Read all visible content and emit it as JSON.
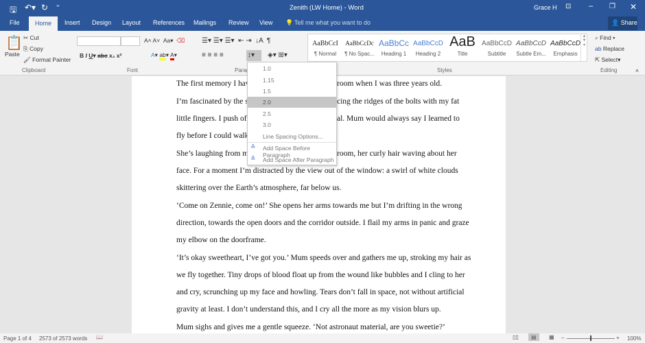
{
  "title": "Zenith (LW Home) - Word",
  "user": "Grace H",
  "tabs": [
    "File",
    "Home",
    "Insert",
    "Design",
    "Layout",
    "References",
    "Mailings",
    "Review",
    "View"
  ],
  "tell_me": "Tell me what you want to do",
  "share": "Share",
  "clipboard": {
    "paste": "Paste",
    "cut": "Cut",
    "copy": "Copy",
    "format_painter": "Format Painter",
    "label": "Clipboard"
  },
  "font": {
    "label": "Font",
    "name": "",
    "size": ""
  },
  "paragraph": {
    "label": "Paragraph"
  },
  "styles": {
    "label": "Styles",
    "items": [
      {
        "preview": "AaBbCcI",
        "name": "¶ Normal"
      },
      {
        "preview": "AaBbCcDc",
        "name": "¶ No Spac..."
      },
      {
        "preview": "AaBbCc",
        "name": "Heading 1"
      },
      {
        "preview": "AaBbCcD",
        "name": "Heading 2"
      },
      {
        "preview": "AaB",
        "name": "Title"
      },
      {
        "preview": "AaBbCcD",
        "name": "Subtitle"
      },
      {
        "preview": "AaBbCcD",
        "name": "Subtle Em..."
      },
      {
        "preview": "AaBbCcD",
        "name": "Emphasis"
      }
    ]
  },
  "editing": {
    "label": "Editing",
    "find": "Find",
    "replace": "Replace",
    "select": "Select"
  },
  "line_spacing_menu": {
    "options": [
      "1.0",
      "1.15",
      "1.5",
      "2.0",
      "2.5",
      "3.0"
    ],
    "selected": "2.0",
    "more": "Line Spacing Options...",
    "before": "Add Space Before Paragraph",
    "after": "Add Space After Paragraph"
  },
  "document": {
    "lines": [
      "The first memory I hav",
      "room when I was three years old.",
      "I’m fascinated by the st",
      "cing the ridges of the bolts with my fat",
      "little fingers. I push off",
      "al. Mum would always say I learned to",
      "fly before I could walk",
      "She’s laughing from m",
      "room, her curly hair waving about her",
      "face. For a moment I’m distracted by the view out of the window: a swirl of white clouds",
      "skittering over the Earth’s atmosphere, far below us.",
      "‘Come on Zennie, come on!’ She opens her arms towards me but I’m drifting in the wrong",
      "direction, towards the open doors and the corridor outside. I flail my arms in panic and graze",
      "my elbow on the doorframe.",
      "‘It’s okay sweetheart, I’ve got you.’ Mum speeds over and gathers me up, stroking my hair as",
      "we fly together. Tiny drops of blood float up from the wound like bubbles and I cling to her",
      "and cry, scrunching up my face and howling. Tears don’t fall in space, not without artificial",
      "gravity at least. I don’t understand this, and I cry all the more as my vision blurs up.",
      "Mum sighs and gives me a gentle squeeze. ‘Not astronaut material, are you sweetie?’"
    ]
  },
  "status": {
    "page": "Page 1 of 4",
    "words": "2573 of 2573 words",
    "zoom": "100%"
  },
  "colors": {
    "brand": "#2b579a",
    "highlight": "#ffff00",
    "font_color": "#e00000"
  }
}
